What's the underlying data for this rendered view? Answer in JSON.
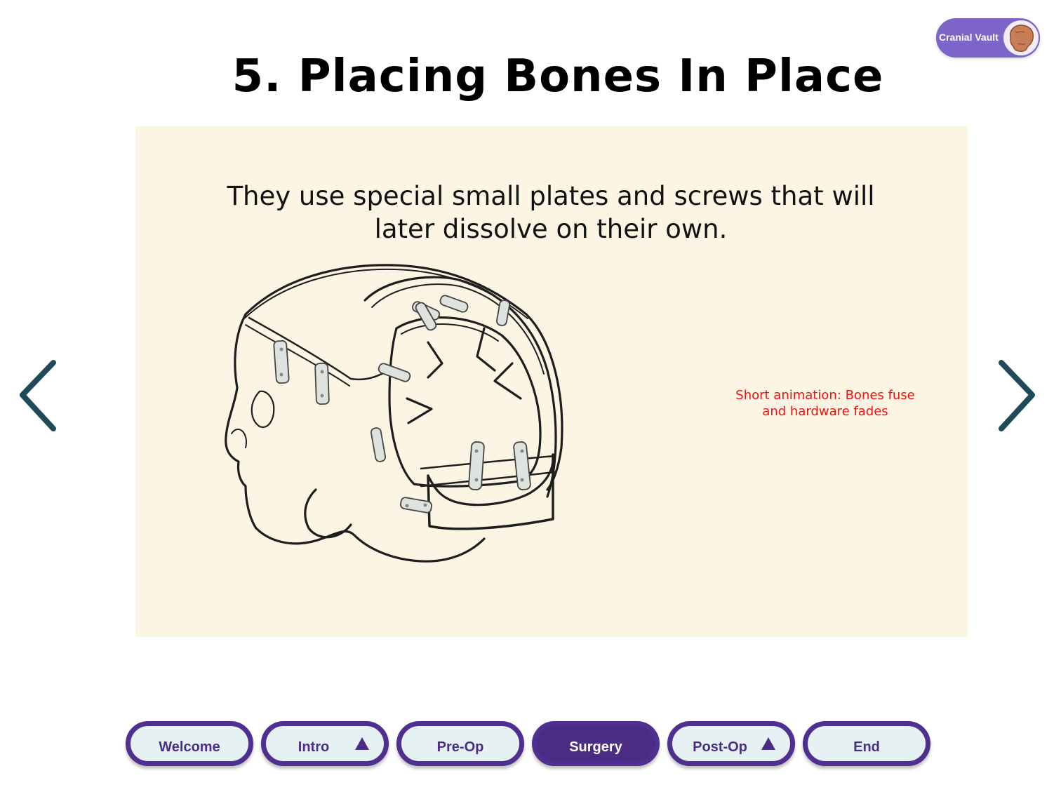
{
  "badge": {
    "label": "Cranial Vault",
    "avatar_icon": "skull-avatar-icon"
  },
  "title": "5. Placing Bones In Place",
  "slide": {
    "caption": "They use special small plates and screws that will later dissolve on their own.",
    "note": "Short animation: Bones fuse and hardware fades",
    "illustration": "skull-with-plates-illustration"
  },
  "nav": {
    "prev_icon": "chevron-left-icon",
    "next_icon": "chevron-right-icon"
  },
  "tabs": [
    {
      "label": "Welcome",
      "active": false,
      "icon": null
    },
    {
      "label": "Intro",
      "active": false,
      "icon": "triangle-up-icon"
    },
    {
      "label": "Pre-Op",
      "active": false,
      "icon": null
    },
    {
      "label": "Surgery",
      "active": true,
      "icon": null
    },
    {
      "label": "Post-Op",
      "active": false,
      "icon": "triangle-up-icon"
    },
    {
      "label": "End",
      "active": false,
      "icon": null
    }
  ],
  "colors": {
    "accent": "#4f2f8f",
    "badge": "#7c64c8",
    "panel": "#fdf5e4",
    "note": "#ee1111",
    "arrow": "#1f4a5a"
  }
}
